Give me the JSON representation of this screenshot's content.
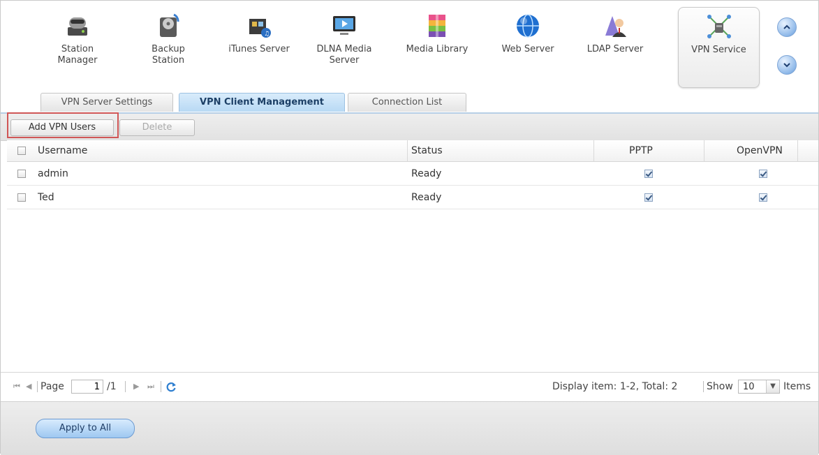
{
  "apps": [
    {
      "label": "Station\nManager",
      "icon": "station-manager-icon"
    },
    {
      "label": "Backup\nStation",
      "icon": "backup-station-icon"
    },
    {
      "label": "iTunes Server",
      "icon": "itunes-server-icon"
    },
    {
      "label": "DLNA Media\nServer",
      "icon": "dlna-media-server-icon"
    },
    {
      "label": "Media Library",
      "icon": "media-library-icon"
    },
    {
      "label": "Web Server",
      "icon": "web-server-icon"
    },
    {
      "label": "LDAP Server",
      "icon": "ldap-server-icon"
    },
    {
      "label": "VPN Service",
      "icon": "vpn-service-icon",
      "selected": true
    }
  ],
  "tabs": [
    {
      "label": "VPN Server Settings"
    },
    {
      "label": "VPN Client Management",
      "active": true
    },
    {
      "label": "Connection List"
    }
  ],
  "toolbar": {
    "add_label": "Add VPN Users",
    "delete_label": "Delete"
  },
  "grid": {
    "headers": {
      "username": "Username",
      "status": "Status",
      "pptp": "PPTP",
      "openvpn": "OpenVPN"
    },
    "rows": [
      {
        "username": "admin",
        "status": "Ready",
        "pptp": true,
        "openvpn": true
      },
      {
        "username": "Ted",
        "status": "Ready",
        "pptp": true,
        "openvpn": true
      }
    ]
  },
  "pager": {
    "page_label": "Page",
    "page_value": "1",
    "total_pages": "/1",
    "display_text": "Display item: 1-2, Total: 2",
    "show_label": "Show",
    "show_value": "10",
    "items_label": "Items"
  },
  "footer": {
    "apply_label": "Apply to All"
  },
  "colors": {
    "accent": "#b8d9f4",
    "highlight": "#d05656"
  }
}
